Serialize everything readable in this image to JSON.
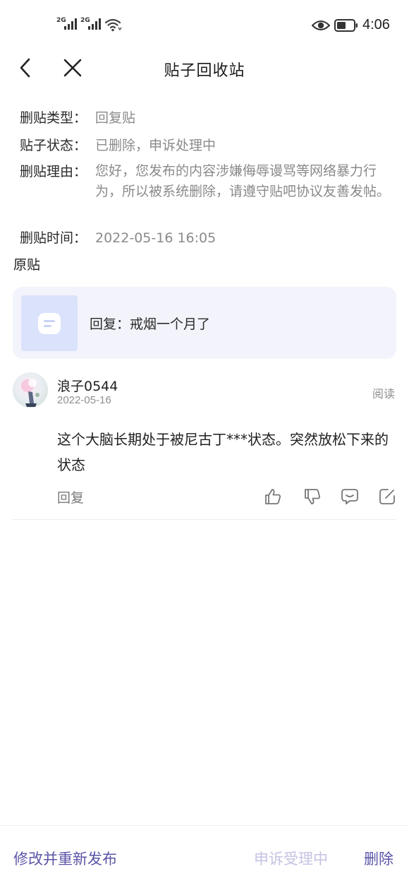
{
  "status_bar": {
    "sim1_type": "2G",
    "sim2_type": "2G",
    "time": "4:06"
  },
  "nav": {
    "title": "贴子回收站"
  },
  "info": {
    "type_label": "删贴类型：",
    "type_value": "回复贴",
    "status_label": "贴子状态：",
    "status_value": "已删除，申诉处理中",
    "reason_label": "删贴理由：",
    "reason_value": "您好，您发布的内容涉嫌侮辱谩骂等网络暴力行为，所以被系统删除，请遵守贴吧协议友善发帖。",
    "time_label": "删贴时间：",
    "time_value": "2022-05-16 16:05"
  },
  "original": {
    "section_label": "原贴",
    "card_text": "回复：戒烟一个月了"
  },
  "comment": {
    "username": "浪子0544",
    "date": "2022-05-16",
    "read_label": "阅读",
    "body": " 这个大脑长期处于被尼古丁***状态。突然放松下来的状态",
    "reply_label": "回复"
  },
  "actions": {
    "republish": "修改并重新发布",
    "appeal": "申诉受理中",
    "delete": "删除"
  },
  "colors": {
    "accent": "#5b55a8",
    "accent_disabled": "#c5c3e3",
    "muted_text": "#8a8a8a",
    "card_bg": "#f3f4fb"
  }
}
